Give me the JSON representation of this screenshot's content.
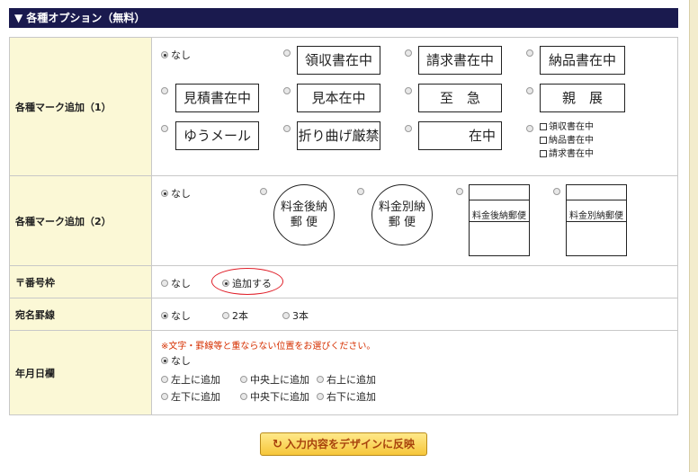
{
  "section": {
    "title": "▼ 各種オプション（無料）"
  },
  "row1": {
    "label": "各種マーク追加（1）",
    "none_label": "なし",
    "marks": [
      "領収書在中",
      "請求書在中",
      "納品書在中",
      "見積書在中",
      "見本在中",
      "至　急",
      "親　展",
      "ゆうメール",
      "折り曲げ厳禁",
      "在中"
    ],
    "checkboxes": [
      "領収書在中",
      "納品書在中",
      "請求書在中"
    ]
  },
  "row2": {
    "label": "各種マーク追加（2）",
    "none_label": "なし",
    "circle1": [
      "料金後納",
      "郵 便"
    ],
    "circle2": [
      "料金別納",
      "郵 便"
    ],
    "stamp1": "料金後納郵便",
    "stamp2": "料金別納郵便"
  },
  "row3": {
    "label": "〒番号枠",
    "options": [
      "なし",
      "追加する"
    ],
    "selected": "追加する"
  },
  "row4": {
    "label": "宛名罫線",
    "options": [
      "なし",
      "2本",
      "3本"
    ],
    "selected": "なし"
  },
  "row5": {
    "label": "年月日欄",
    "note": "※文字・罫線等と重ならない位置をお選びください。",
    "options": [
      "なし",
      "左上に追加",
      "中央上に追加",
      "右上に追加",
      "左下に追加",
      "中央下に追加",
      "右下に追加"
    ],
    "selected": "なし"
  },
  "button": {
    "label": "入力内容をデザインに反映",
    "icon": "refresh-icon"
  },
  "colors": {
    "header_bg": "#1a1a4e",
    "label_bg": "#fbf8d6",
    "note": "#d63000",
    "highlight": "#e0202a"
  }
}
